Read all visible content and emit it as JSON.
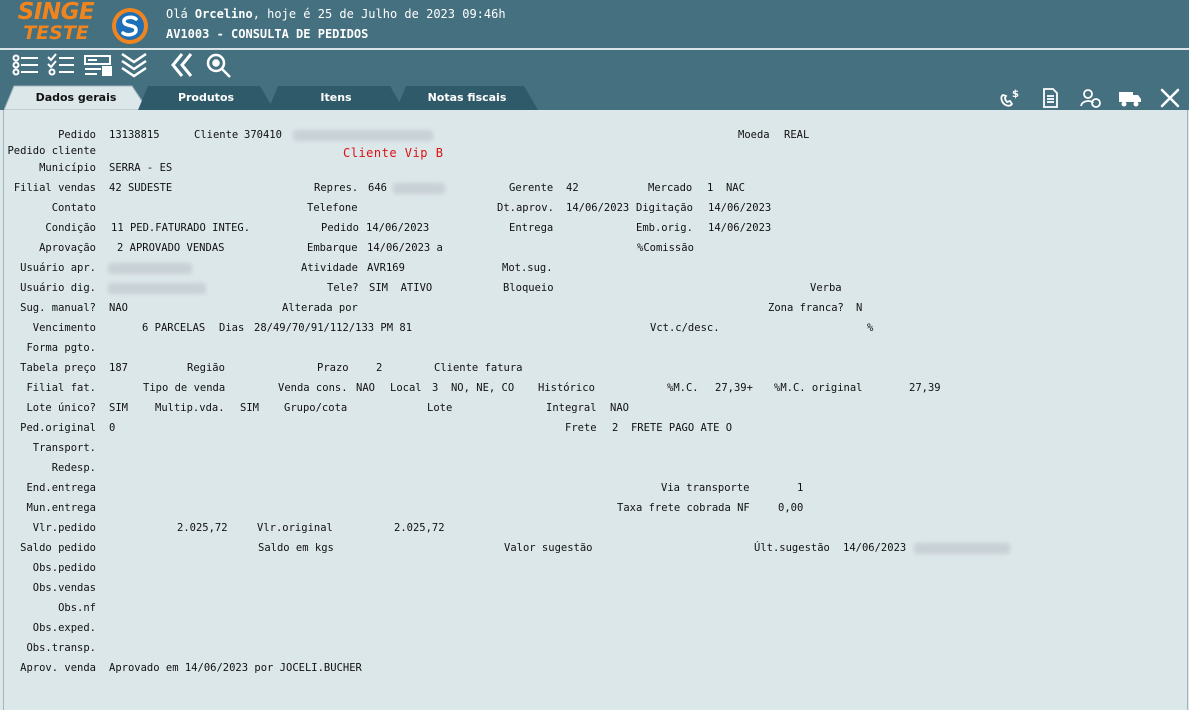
{
  "header": {
    "logo_line1": "SINGE",
    "logo_line2": "TESTE",
    "greeting_prefix": "Olá ",
    "user_name": "Orcelino",
    "greeting_suffix": ", hoje é 25 de Julho de 2023 09:46h",
    "screen_title": "AV1003 - CONSULTA DE PEDIDOS",
    "brand_color": "#f0851f",
    "bar_color": "#45707f"
  },
  "toolbar": {
    "icons": [
      "list-icon",
      "checklist-icon",
      "form-icon",
      "double-chevron-down-icon",
      "back-icon",
      "search-icon"
    ]
  },
  "tabs": [
    "Dados gerais",
    "Produtos",
    "Itens",
    "Notas fiscais"
  ],
  "right_icons": [
    "money-phone-icon",
    "document-icon",
    "user-money-icon",
    "truck-icon",
    "tools-icon"
  ],
  "form": {
    "pedido_lbl": "Pedido",
    "pedido_val": "13138815",
    "cliente_lbl": "Cliente",
    "cliente_val": "370410",
    "moeda_lbl": "Moeda",
    "moeda_val": "REAL",
    "pedido_cliente_lbl": "Pedido cliente",
    "vip": "Cliente Vip B",
    "municipio_lbl": "Município",
    "municipio_val": "SERRA - ES",
    "filial_vendas_lbl": "Filial vendas",
    "filial_vendas_val": "42 SUDESTE",
    "repres_lbl": "Repres.",
    "repres_val": "646",
    "gerente_lbl": "Gerente",
    "gerente_val": "42",
    "mercado_lbl": "Mercado",
    "mercado_val": "1  NAC",
    "contato_lbl": "Contato",
    "telefone_lbl": "Telefone",
    "dt_aprov_lbl": "Dt.aprov.",
    "dt_aprov_val": "14/06/2023",
    "digitacao_lbl": "Digitação",
    "digitacao_val": "14/06/2023",
    "condicao_lbl": "Condição",
    "condicao_val": "11 PED.FATURADO INTEG.",
    "pedido2_lbl": "Pedido",
    "pedido2_val": "14/06/2023",
    "entrega_lbl": "Entrega",
    "emb_orig_lbl": "Emb.orig.",
    "emb_orig_val": "14/06/2023",
    "aprovacao_lbl": "Aprovação",
    "aprovacao_val": "2 APROVADO VENDAS",
    "embarque_lbl": "Embarque",
    "embarque_val": "14/06/2023 a",
    "comissao_lbl": "%Comissão",
    "usuario_apr_lbl": "Usuário apr.",
    "atividade_lbl": "Atividade",
    "atividade_val": "AVR169",
    "mot_sug_lbl": "Mot.sug.",
    "usuario_dig_lbl": "Usuário dig.",
    "tele_lbl": "Tele?",
    "tele_val": "SIM  ATIVO",
    "bloqueio_lbl": "Bloqueio",
    "verba_lbl": "Verba",
    "sug_manual_lbl": "Sug. manual?",
    "sug_manual_val": "NAO",
    "alterada_por_lbl": "Alterada por",
    "zona_franca_lbl": "Zona franca?",
    "zona_franca_val": "N",
    "vencimento_lbl": "Vencimento",
    "vencimento_val": "6 PARCELAS",
    "dias_lbl": "Dias",
    "dias_val": "28/49/70/91/112/133 PM 81",
    "vct_desc_lbl": "Vct.c/desc.",
    "pct_sign": "%",
    "forma_pgto_lbl": "Forma pgto.",
    "tabela_preco_lbl": "Tabela preço",
    "tabela_preco_val": "187",
    "regiao_lbl": "Região",
    "prazo_lbl": "Prazo",
    "prazo_val": "2",
    "cliente_fatura_lbl": "Cliente fatura",
    "filial_fat_lbl": "Filial fat.",
    "tipo_venda_lbl": "Tipo de venda",
    "venda_cons_lbl": "Venda cons.",
    "venda_cons_val": "NAO",
    "local_lbl": "Local",
    "local_val": "3  NO, NE, CO",
    "historico_lbl": "Histórico",
    "mc_lbl": "%M.C.",
    "mc_val": "27,39+",
    "mc_orig_lbl": "%M.C. original",
    "mc_orig_val": "27,39",
    "lote_unico_lbl": "Lote único?",
    "lote_unico_val": "SIM",
    "multip_lbl": "Multip.vda.",
    "multip_val": "SIM",
    "grupo_cota_lbl": "Grupo/cota",
    "lote_lbl": "Lote",
    "integral_lbl": "Integral",
    "integral_val": "NAO",
    "ped_original_lbl": "Ped.original",
    "ped_original_val": "0",
    "frete_lbl": "Frete",
    "frete_val": "2  FRETE PAGO ATE O",
    "transport_lbl": "Transport.",
    "redesp_lbl": "Redesp.",
    "end_entrega_lbl": "End.entrega",
    "via_transporte_lbl": "Via transporte",
    "via_transporte_val": "1",
    "mun_entrega_lbl": "Mun.entrega",
    "taxa_frete_lbl": "Taxa frete cobrada NF",
    "taxa_frete_val": "0,00",
    "vlr_pedido_lbl": "Vlr.pedido",
    "vlr_pedido_val": "2.025,72",
    "vlr_original_lbl": "Vlr.original",
    "vlr_original_val": "2.025,72",
    "saldo_pedido_lbl": "Saldo pedido",
    "saldo_kgs_lbl": "Saldo em kgs",
    "valor_sugestao_lbl": "Valor sugestão",
    "ult_sugestao_lbl": "Últ.sugestão",
    "ult_sugestao_val": "14/06/2023",
    "obs_pedido_lbl": "Obs.pedido",
    "obs_vendas_lbl": "Obs.vendas",
    "obs_nf_lbl": "Obs.nf",
    "obs_exped_lbl": "Obs.exped.",
    "obs_transp_lbl": "Obs.transp.",
    "aprov_venda_lbl": "Aprov. venda",
    "aprov_venda_val": "Aprovado em 14/06/2023 por JOCELI.BUCHER"
  }
}
